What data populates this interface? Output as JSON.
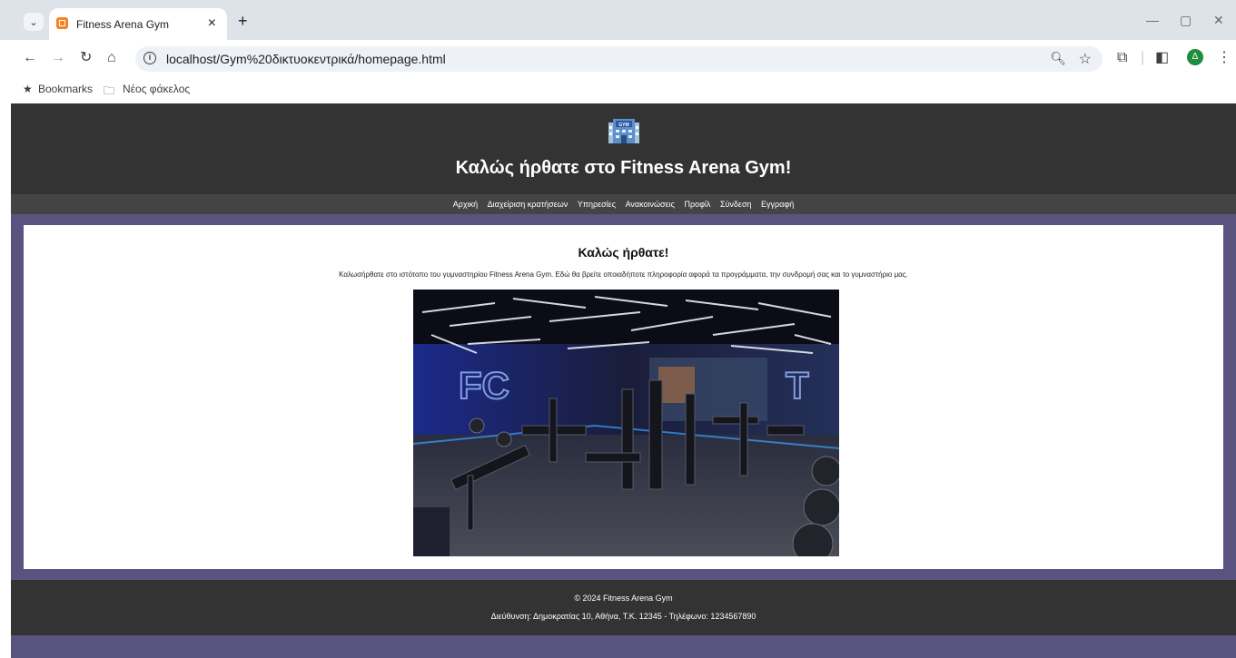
{
  "browser": {
    "tab_title": "Fitness Arena Gym",
    "tab_close": "×",
    "new_tab": "+",
    "url": "localhost/Gym%20δικτυοκεντρικά/homepage.html",
    "profile_initial": "Δ",
    "bookmarks": {
      "label": "Bookmarks",
      "folder": "Νέος φάκελος"
    }
  },
  "site": {
    "logo_text": "GYM",
    "title": "Καλώς ήρθατε στο Fitness Arena Gym!",
    "nav": [
      "Αρχική",
      "Διαχείριση κρατήσεων",
      "Υπηρεσίες",
      "Ανακοινώσεις",
      "Προφίλ",
      "Σύνδεση",
      "Εγγραφή"
    ],
    "welcome_heading": "Καλώς ήρθατε!",
    "welcome_text": "Καλωσήρθατε στο ιστότοπο του γυμναστηρίου Fitness Arena Gym. Εδώ θα βρείτε οποιαδήποτε πληροφορία αφορά τα προγράμματα, την συνδρομή σας και το γυμναστήριο μας.",
    "footer_copyright": "© 2024 Fitness Arena Gym",
    "footer_address": "Διεύθυνση: Δημοκρατίας 10, Αθήνα, Τ.Κ. 12345 - Τηλέφωνο: 1234567890"
  },
  "colors": {
    "page_bg": "#59537f",
    "header_bg": "#333333",
    "nav_bg": "#444444",
    "content_bg": "#ffffff"
  }
}
